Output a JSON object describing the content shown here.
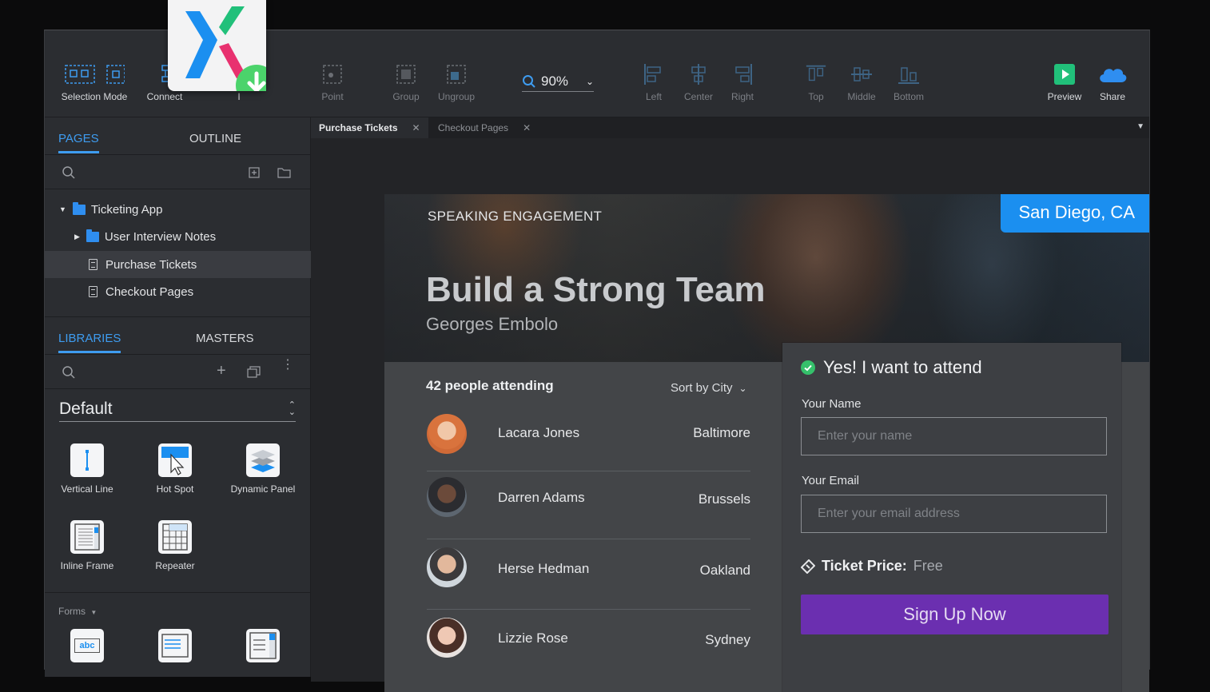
{
  "toolbar": {
    "selection_mode": "Selection Mode",
    "connect": "Connect",
    "partial": "I",
    "point": "Point",
    "group": "Group",
    "ungroup": "Ungroup",
    "zoom": "90%",
    "left": "Left",
    "center": "Center",
    "right": "Right",
    "top": "Top",
    "middle": "Middle",
    "bottom": "Bottom",
    "preview": "Preview",
    "share": "Share"
  },
  "pages_panel": {
    "tabs": [
      "PAGES",
      "OUTLINE"
    ],
    "tree": [
      {
        "label": "Ticketing App",
        "type": "folder",
        "expanded": true
      },
      {
        "label": "User Interview Notes",
        "type": "folder",
        "expanded": false
      },
      {
        "label": "Purchase Tickets",
        "type": "page",
        "selected": true
      },
      {
        "label": "Checkout Pages",
        "type": "page"
      }
    ]
  },
  "libraries_panel": {
    "tabs": [
      "LIBRARIES",
      "MASTERS"
    ],
    "library": "Default",
    "items": [
      "Vertical Line",
      "Hot Spot",
      "Dynamic Panel",
      "Inline Frame",
      "Repeater"
    ],
    "section": "Forms",
    "form_icons": [
      "abc"
    ]
  },
  "doc_tabs": [
    {
      "label": "Purchase Tickets",
      "active": true
    },
    {
      "label": "Checkout Pages",
      "active": false
    }
  ],
  "design": {
    "eyebrow": "SPEAKING ENGAGEMENT",
    "title": "Build a Strong Team",
    "speaker": "Georges Embolo",
    "location": "San Diego, CA",
    "attending": "42 people attending",
    "sort": "Sort by City",
    "people": [
      {
        "name": "Lacara Jones",
        "city": "Baltimore"
      },
      {
        "name": "Darren Adams",
        "city": "Brussels"
      },
      {
        "name": "Herse Hedman",
        "city": "Oakland"
      },
      {
        "name": "Lizzie Rose",
        "city": "Sydney"
      }
    ],
    "form": {
      "heading": "Yes! I want to attend",
      "name_label": "Your Name",
      "name_placeholder": "Enter your name",
      "email_label": "Your Email",
      "email_placeholder": "Enter your email address",
      "price_label": "Ticket Price:",
      "price_value": "Free",
      "button": "Sign Up Now"
    }
  },
  "colors": {
    "accent_blue": "#3e9cf0",
    "badge_blue": "#1b8ff0",
    "signup_purple": "#6b2fb0",
    "check_green": "#35c06b"
  }
}
